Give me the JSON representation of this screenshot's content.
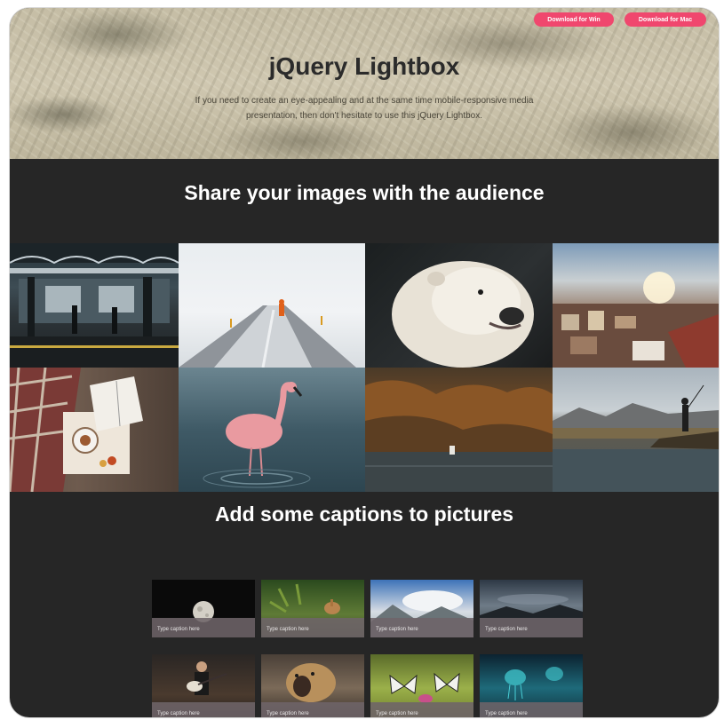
{
  "hero": {
    "download_win": "Download for Win",
    "download_mac": "Download for Mac",
    "title": "jQuery Lightbox",
    "description": "If you need to create an eye-appealing and at the same time mobile-responsive media presentation, then don't hesitate to use this jQuery Lightbox."
  },
  "gallery": {
    "heading": "Share your images with the audience",
    "items": [
      {
        "subject": "subway-station"
      },
      {
        "subject": "snowy-road-person"
      },
      {
        "subject": "polar-bear"
      },
      {
        "subject": "city-rooftops-sunset"
      },
      {
        "subject": "tea-book-blanket"
      },
      {
        "subject": "flamingo"
      },
      {
        "subject": "autumn-lake"
      },
      {
        "subject": "fisherman-lake"
      }
    ]
  },
  "captions": {
    "heading": "Add some captions to pictures",
    "items": [
      {
        "caption": "Type caption here",
        "subject": "moon"
      },
      {
        "caption": "Type caption here",
        "subject": "deer"
      },
      {
        "caption": "Type caption here",
        "subject": "mountain-clouds"
      },
      {
        "caption": "Type caption here",
        "subject": "night-landscape"
      },
      {
        "caption": "Type caption here",
        "subject": "guitarist"
      },
      {
        "caption": "Type caption here",
        "subject": "lion"
      },
      {
        "caption": "Type caption here",
        "subject": "butterflies"
      },
      {
        "caption": "Type caption here",
        "subject": "jellyfish"
      }
    ]
  },
  "colors": {
    "accent": "#f0476e",
    "dark_bg": "#262626",
    "hero_bg": "#c9c1a8"
  }
}
